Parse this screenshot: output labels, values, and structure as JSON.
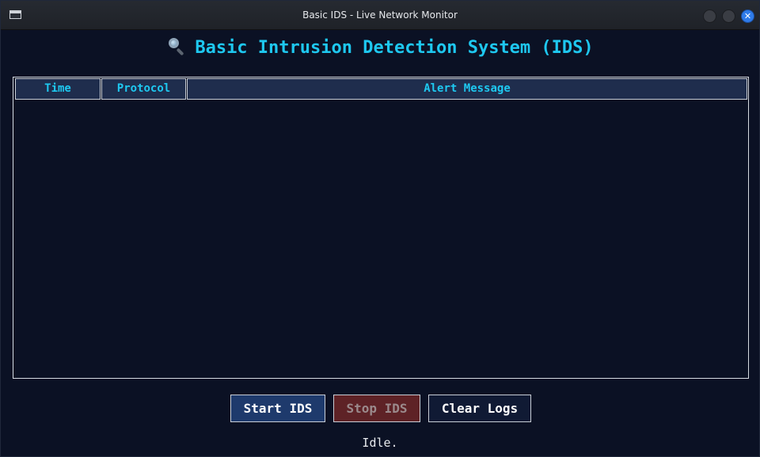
{
  "window": {
    "title": "Basic IDS - Live Network Monitor",
    "close_glyph": "✕"
  },
  "app": {
    "heading_icon": "magnifier-icon",
    "heading": "Basic Intrusion Detection System (IDS)"
  },
  "table": {
    "columns": [
      "Time",
      "Protocol",
      "Alert Message"
    ],
    "rows": []
  },
  "controls": {
    "start_label": "Start IDS",
    "stop_label": "Stop IDS",
    "clear_label": "Clear Logs",
    "stop_enabled": false
  },
  "status": {
    "text": "Idle."
  },
  "colors": {
    "accent": "#1ec8f0",
    "background": "#0b1124",
    "header_bg": "#1f2d4d",
    "start_bg": "#1e3a6c",
    "stop_bg": "#5e2226"
  }
}
